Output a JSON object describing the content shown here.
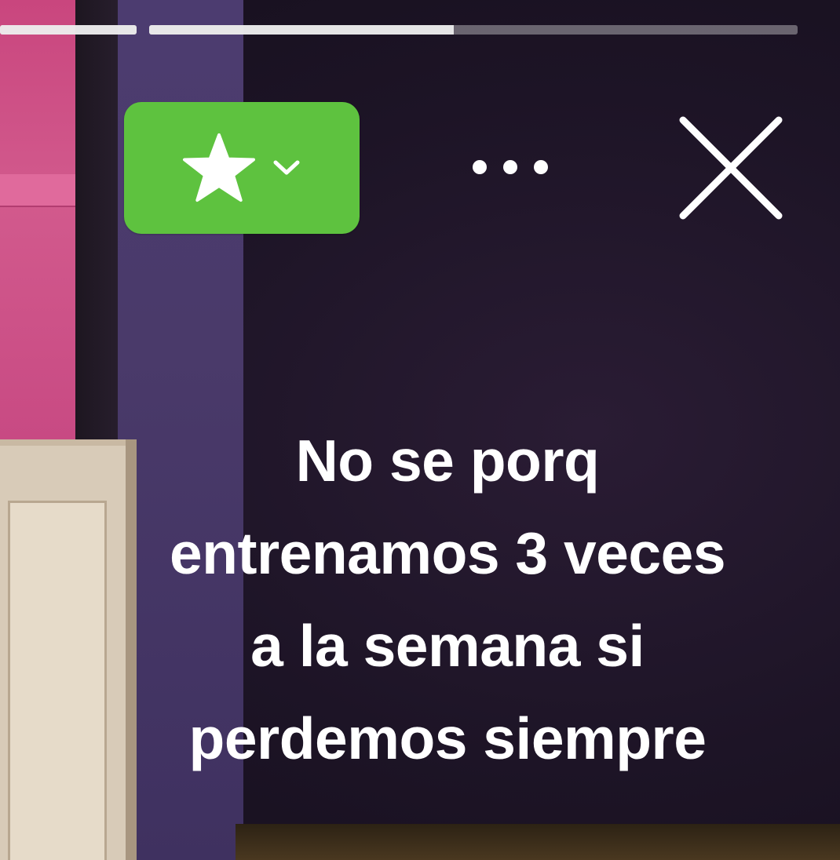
{
  "story": {
    "progress": [
      {
        "fill_fraction": 1.0
      },
      {
        "fill_fraction": 0.47
      }
    ],
    "badge": {
      "icon": "star-icon",
      "chevron_icon": "chevron-down-icon",
      "color": "#5ec23f"
    },
    "more_icon": "ellipsis-icon",
    "close_icon": "close-icon",
    "caption_lines": [
      "No se porq",
      "entrenamos 3 veces",
      "a la semana si",
      "perdemos siempre"
    ]
  }
}
